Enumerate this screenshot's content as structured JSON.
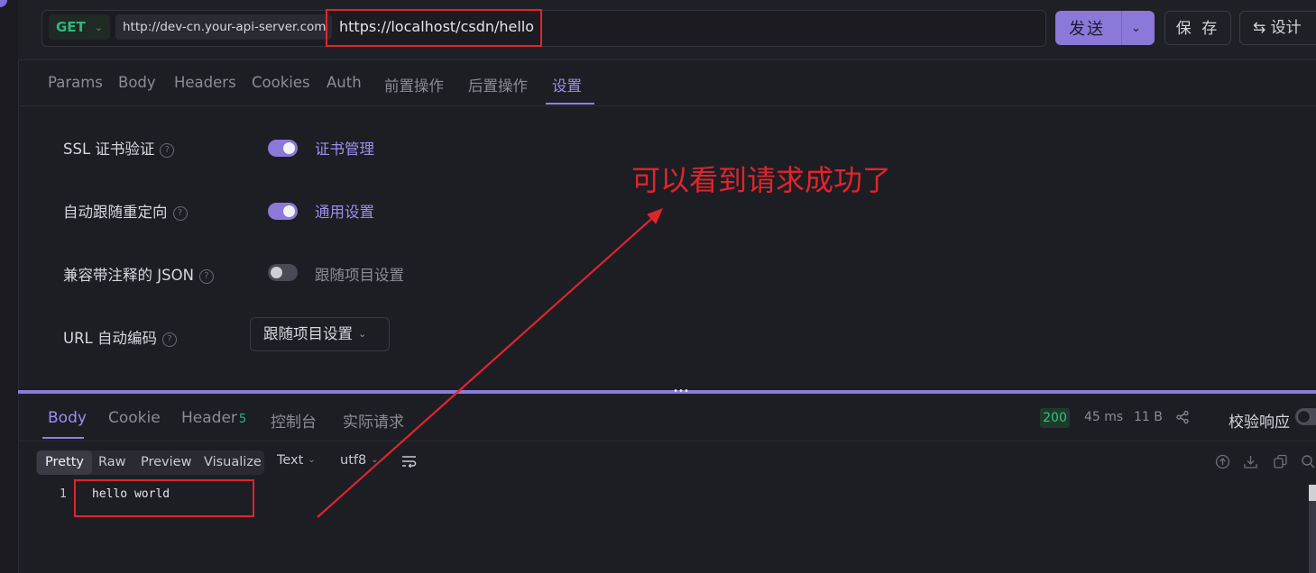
{
  "topbar": {
    "method": "GET",
    "base_url": "http://dev-cn.your-api-server.com",
    "path": "https://localhost/csdn/hello",
    "send_label": "发送",
    "save_label": "保 存",
    "design_label": "⇆ 设计"
  },
  "request_tabs": [
    {
      "label": "Params"
    },
    {
      "label": "Body"
    },
    {
      "label": "Headers"
    },
    {
      "label": "Cookies"
    },
    {
      "label": "Auth"
    },
    {
      "label": "前置操作"
    },
    {
      "label": "后置操作"
    },
    {
      "label": "设置",
      "active": true
    }
  ],
  "settings": {
    "ssl": {
      "label": "SSL 证书验证",
      "toggle": "on",
      "link": "证书管理"
    },
    "redirect": {
      "label": "自动跟随重定向",
      "toggle": "on",
      "link": "通用设置"
    },
    "json_comments": {
      "label": "兼容带注释的 JSON",
      "toggle": "off",
      "note": "跟随项目设置"
    },
    "url_encode": {
      "label": "URL 自动编码",
      "select_value": "跟随项目设置"
    }
  },
  "annotation": "可以看到请求成功了",
  "response": {
    "tabs": {
      "body": "Body",
      "cookie": "Cookie",
      "header": "Header",
      "header_count": "5",
      "console": "控制台",
      "actual": "实际请求"
    },
    "status": "200",
    "time": "45 ms",
    "size": "11 B",
    "validate_label": "校验响应",
    "formats": {
      "pretty": "Pretty",
      "raw": "Raw",
      "preview": "Preview",
      "visualize": "Visualize"
    },
    "content_type": "Text",
    "encoding": "utf8",
    "line_number": "1",
    "body_text": "hello world"
  },
  "colors": {
    "accent": "#8b78d9",
    "method_green": "#2eb67d",
    "annotation_red": "#e0252b"
  },
  "icons": [
    "chevron-down-icon",
    "help-circle-icon",
    "share-icon",
    "wrap-lines-icon",
    "upload-icon",
    "download-icon",
    "copy-icon",
    "search-icon"
  ]
}
